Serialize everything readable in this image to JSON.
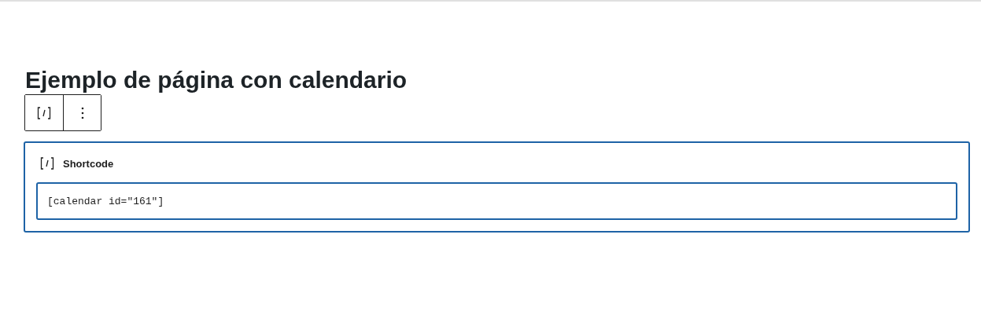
{
  "page_title": "Ejemplo de página con calendario",
  "shortcode_block": {
    "label": "Shortcode",
    "value": "[calendar id=\"161\"]"
  }
}
